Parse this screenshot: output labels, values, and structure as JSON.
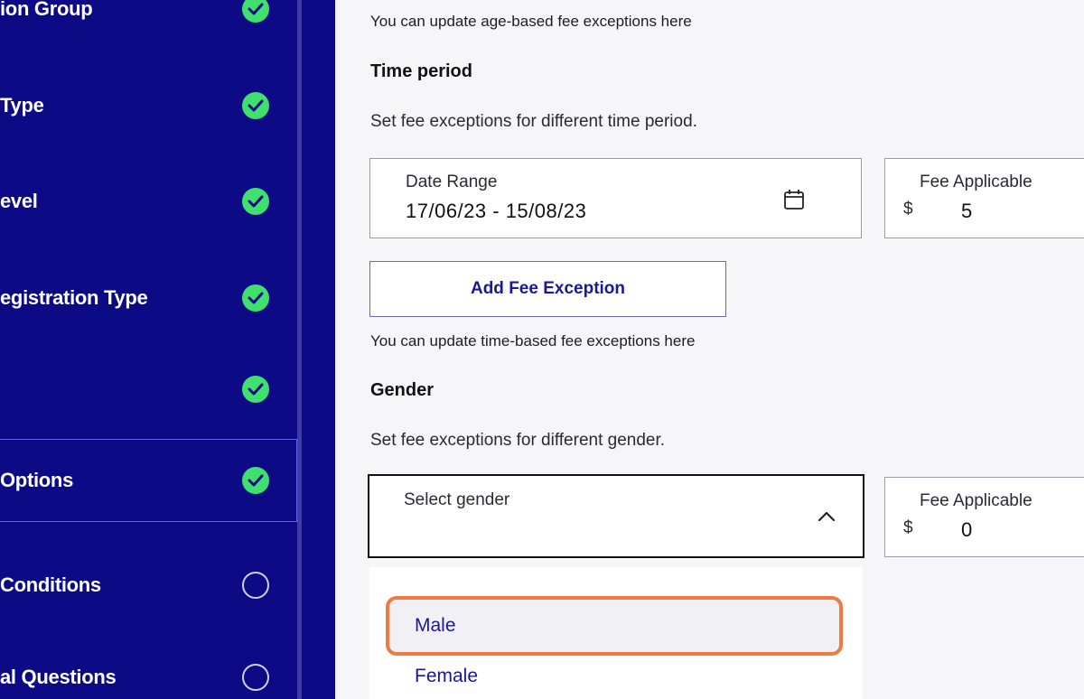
{
  "sidebar": {
    "items": [
      {
        "label": "ion Group",
        "status": "complete"
      },
      {
        "label": "Type",
        "status": "complete"
      },
      {
        "label": "evel",
        "status": "complete"
      },
      {
        "label": "egistration Type",
        "status": "complete"
      },
      {
        "label": "",
        "status": "complete"
      },
      {
        "label": "Options",
        "status": "complete",
        "active": true
      },
      {
        "label": "Conditions",
        "status": "incomplete"
      },
      {
        "label": "al Questions",
        "status": "incomplete"
      }
    ]
  },
  "age_section": {
    "hint": "You can update age-based fee exceptions here"
  },
  "time_section": {
    "title": "Time period",
    "description": "Set fee exceptions for different time period.",
    "date_range_caption": "Date Range",
    "date_range_value": "17/06/23 - 15/08/23",
    "fee_caption": "Fee Applicable",
    "fee_currency": "$",
    "fee_value": "5",
    "add_button": "Add Fee Exception",
    "hint": "You can update time-based fee exceptions here"
  },
  "gender_section": {
    "title": "Gender",
    "description": "Set fee exceptions for different gender.",
    "select_placeholder": "Select gender",
    "fee_caption": "Fee Applicable",
    "fee_currency": "$",
    "fee_value": "0",
    "options": [
      "Male",
      "Female"
    ],
    "highlighted_option": "Male"
  },
  "colors": {
    "sidebar_bg": "#0c0a85",
    "check_green": "#3fe06e",
    "highlight_orange": "#f07a45",
    "button_text": "#1a1896"
  }
}
